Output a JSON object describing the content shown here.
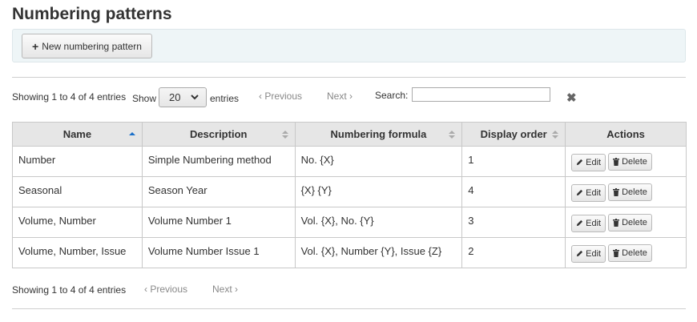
{
  "page": {
    "title": "Numbering patterns"
  },
  "toolbar": {
    "new_label": "New numbering pattern"
  },
  "top": {
    "info": "Showing 1 to 4 of 4 entries",
    "show_label": "Show",
    "page_size": "20",
    "entries_label": "entries",
    "previous": "Previous",
    "next": "Next",
    "search_label": "Search:",
    "search_value": ""
  },
  "table": {
    "headers": [
      "Name",
      "Description",
      "Numbering formula",
      "Display order",
      "Actions"
    ],
    "sorted_column": "Name",
    "rows": [
      {
        "name": "Number",
        "description": "Simple Numbering method",
        "formula": "No. {X}",
        "order": "1",
        "edit": "Edit",
        "delete": "Delete"
      },
      {
        "name": "Seasonal",
        "description": "Season Year",
        "formula": "{X} {Y}",
        "order": "4",
        "edit": "Edit",
        "delete": "Delete"
      },
      {
        "name": "Volume, Number",
        "description": "Volume Number 1",
        "formula": "Vol. {X}, No. {Y}",
        "order": "3",
        "edit": "Edit",
        "delete": "Delete"
      },
      {
        "name": "Volume, Number, Issue",
        "description": "Volume Number Issue 1",
        "formula": "Vol. {X}, Number {Y}, Issue {Z}",
        "order": "2",
        "edit": "Edit",
        "delete": "Delete"
      }
    ]
  },
  "bottom": {
    "info": "Showing 1 to 4 of 4 entries",
    "previous": "Previous",
    "next": "Next"
  },
  "colors": {
    "accent": "#1a6fc9",
    "toolbar_bg": "#eef5f7",
    "header_bg": "#e6e6e6"
  }
}
